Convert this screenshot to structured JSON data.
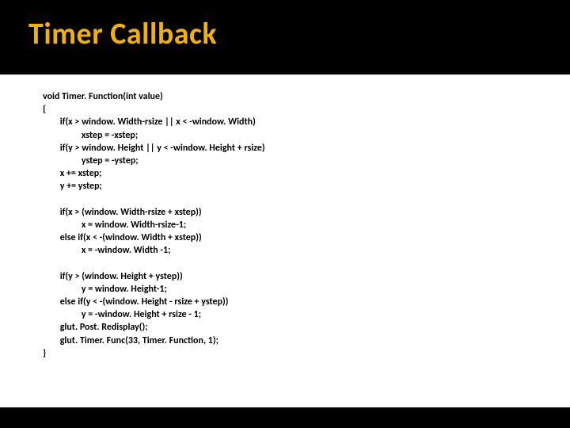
{
  "title": "Timer Callback",
  "code": "void Timer. Function(int value)\n{\n        if(x > window. Width-rsize || x < -window. Width)\n                  xstep = -xstep;\n        if(y > window. Height || y < -window. Height + rsize)\n                  ystep = -ystep;\n        x += xstep;\n        y += ystep;\n\n        if(x > (window. Width-rsize + xstep))\n                  x = window. Width-rsize-1;\n        else if(x < -(window. Width + xstep))\n                  x = -window. Width -1;\n\n        if(y > (window. Height + ystep))\n                  y = window. Height-1;\n        else if(y < -(window. Height - rsize + ystep))\n                  y = -window. Height + rsize - 1;\n        glut. Post. Redisplay();\n        glut. Timer. Func(33, Timer. Function, 1);\n}"
}
